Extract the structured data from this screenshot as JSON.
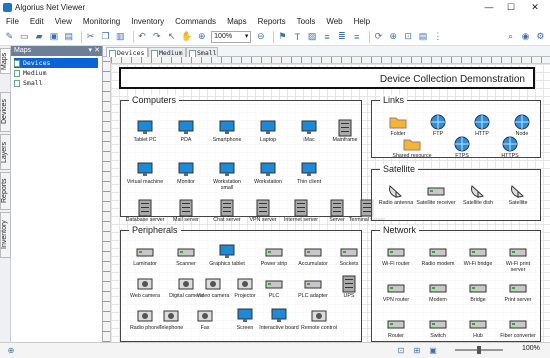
{
  "window": {
    "title": "Algorius Net Viewer"
  },
  "menu": [
    "File",
    "Edit",
    "View",
    "Monitoring",
    "Inventory",
    "Commands",
    "Maps",
    "Reports",
    "Tools",
    "Web",
    "Help"
  ],
  "toolbar": {
    "zoom": "100%"
  },
  "side_tabs": [
    "Maps",
    "Devices",
    "Layers",
    "Reports",
    "Inventory"
  ],
  "maps_panel": {
    "title": "Maps",
    "items": [
      "Devices",
      "Medium",
      "Small"
    ]
  },
  "doc_tabs": [
    "Devices",
    "Medium",
    "Small"
  ],
  "diagram": {
    "title": "Device Collection Demonstration",
    "groups": {
      "computers": {
        "title": "Computers",
        "items": [
          "Tablet PC",
          "PDA",
          "Smartphone",
          "Laptop",
          "iMac",
          "Virtual machine",
          "Monitor",
          "Workstation small",
          "Workstation",
          "Thin client",
          "Mainframe",
          "Database server",
          "Mail server",
          "Chat server",
          "VPN server",
          "Internet server",
          "Server",
          "Terminal server"
        ]
      },
      "links": {
        "title": "Links",
        "items": [
          "Folder",
          "FTP",
          "HTTP",
          "Node",
          "Shared resource",
          "FTPS",
          "HTTPS"
        ]
      },
      "satellite": {
        "title": "Satellite",
        "items": [
          "Radio antenna",
          "Satellite receiver",
          "Satellite dish",
          "Satellite"
        ]
      },
      "peripherals": {
        "title": "Peripherals",
        "items": [
          "Laminator",
          "Scanner",
          "Graphics tablet",
          "Power strip",
          "Accumulator",
          "Sockets",
          "Web camera",
          "Digital camera",
          "Video camera",
          "Projector",
          "PLC",
          "PLC adapter",
          "UPS",
          "Radio phone",
          "Telephone",
          "Fax",
          "Screen",
          "Interactive board",
          "Remote control"
        ]
      },
      "network": {
        "title": "Network",
        "items": [
          "Wi-Fi router",
          "Radio modem",
          "Wi-Fi bridge",
          "Wi-Fi print server",
          "VPN router",
          "Modem",
          "Bridge",
          "Print server",
          "Router",
          "Switch",
          "Hub",
          "Fiber converter"
        ]
      }
    }
  },
  "status": {
    "zoom": "100%"
  },
  "colors": {
    "accent": "#0a64d8",
    "panel_header": "#6d7f96",
    "icon_blue": "#3b6fb0"
  }
}
